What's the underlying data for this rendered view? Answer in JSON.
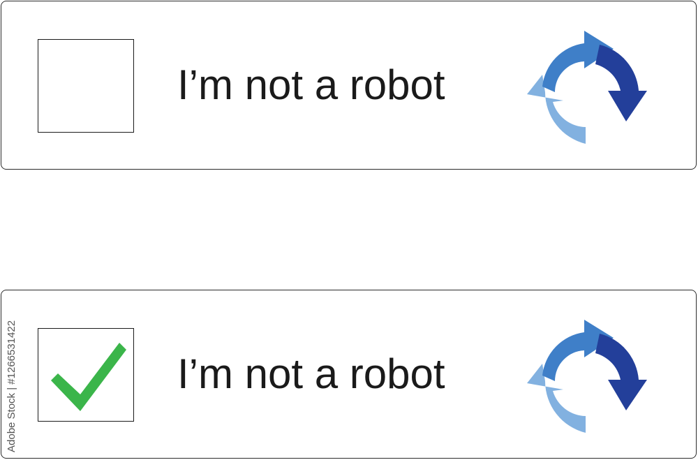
{
  "captchas": [
    {
      "id": "unchecked",
      "label": "I’m not a robot",
      "checked": false,
      "refresh_icon": "refresh-arrows-icon"
    },
    {
      "id": "checked",
      "label": "I’m not a robot",
      "checked": true,
      "check_icon": "checkmark-icon",
      "refresh_icon": "refresh-arrows-icon"
    }
  ],
  "stock_credit": "Adobe Stock | #1266531422",
  "colors": {
    "border": "#2b2b2b",
    "text": "#1a1a1a",
    "checkmark": "#3bb54a",
    "arrow_light": "#82b1e0",
    "arrow_mid": "#3f7fc8",
    "arrow_dark": "#233f9a"
  }
}
